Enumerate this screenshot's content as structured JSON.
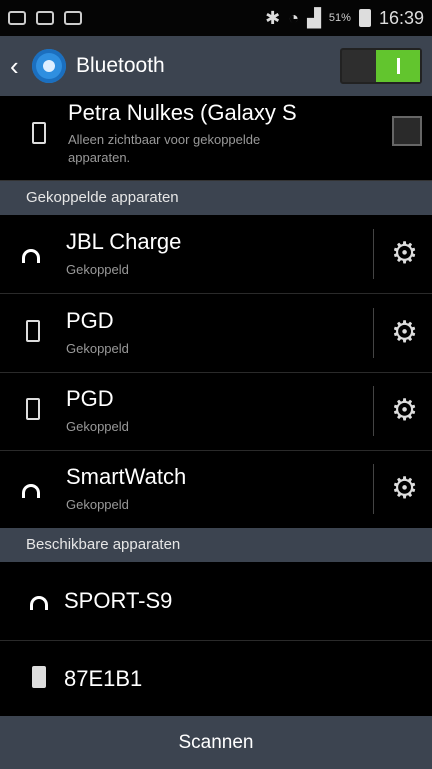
{
  "status_bar": {
    "battery_pct": "51%",
    "time": "16:39"
  },
  "action_bar": {
    "title": "Bluetooth",
    "toggle_on": true
  },
  "own_device": {
    "name": "Petra Nulkes (Galaxy S",
    "visibility_line1": "Alleen zichtbaar voor gekoppelde",
    "visibility_line2": "apparaten."
  },
  "paired_section": {
    "label": "Gekoppelde apparaten"
  },
  "paired": [
    {
      "name": "JBL Charge",
      "status": "Gekoppeld",
      "icon": "headphones-icon"
    },
    {
      "name": "PGD",
      "status": "Gekoppeld",
      "icon": "phone-icon"
    },
    {
      "name": "PGD",
      "status": "Gekoppeld",
      "icon": "phone-icon"
    },
    {
      "name": "SmartWatch",
      "status": "Gekoppeld",
      "icon": "headphones-icon"
    }
  ],
  "available_section": {
    "label": "Beschikbare apparaten"
  },
  "available": [
    {
      "name": "SPORT-S9",
      "icon": "headphones-icon"
    },
    {
      "name": "87E1B1",
      "icon": "device-icon"
    }
  ],
  "scan": {
    "label": "Scannen"
  },
  "colors": {
    "toggle_on": "#62c52e",
    "bar": "#3c4450",
    "bt_icon": "#2f8fe0"
  }
}
